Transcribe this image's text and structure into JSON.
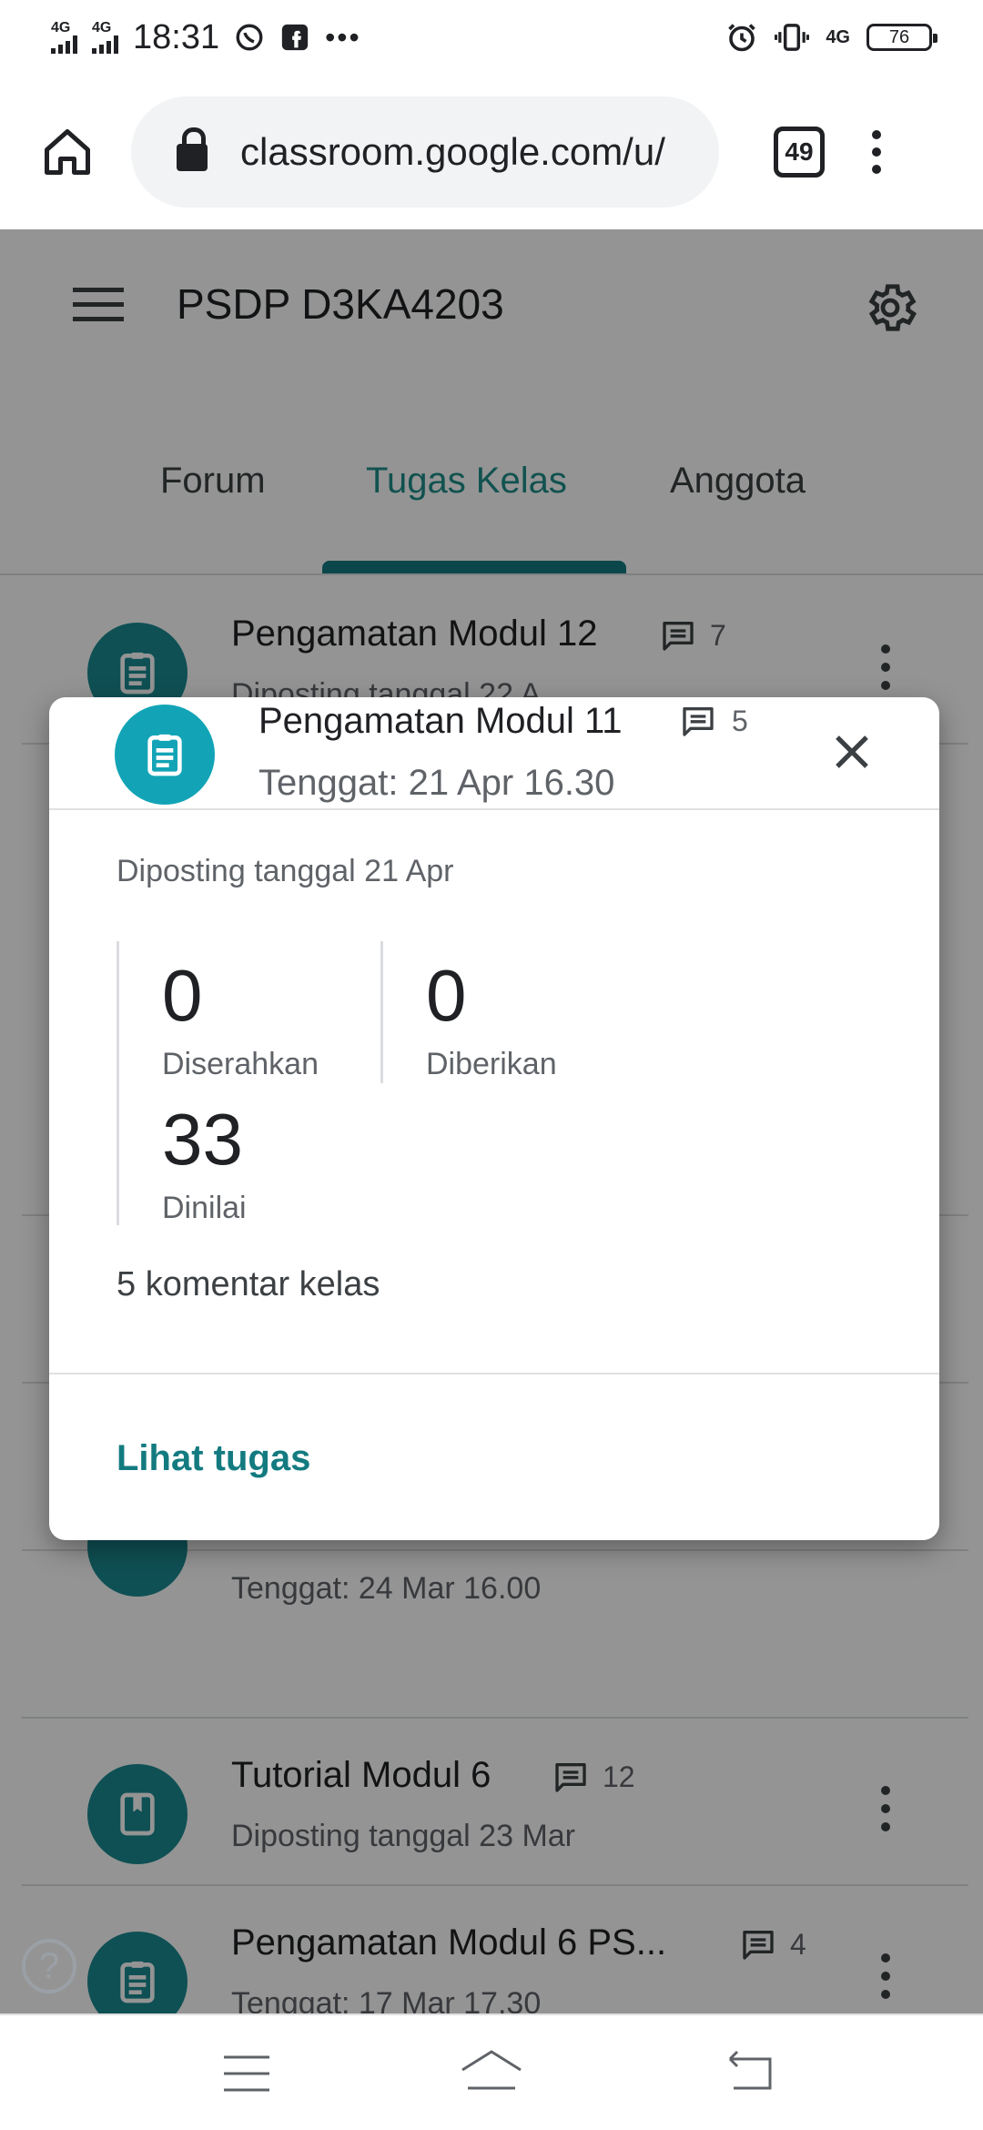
{
  "status_bar": {
    "network_1": "4G",
    "network_2": "4G",
    "time": "18:31",
    "network_3": "4G",
    "battery": "76"
  },
  "browser": {
    "url": "classroom.google.com/u/",
    "tab_count": "49"
  },
  "classroom": {
    "class_name": "PSDP D3KA4203",
    "tabs": [
      {
        "label": "Forum"
      },
      {
        "label": "Tugas Kelas"
      },
      {
        "label": "Anggota"
      }
    ],
    "active_tab": "Tugas Kelas",
    "accent_color": "#137b80",
    "items": [
      {
        "title": "Pengamatan Modul 12",
        "comments": "7",
        "subtitle": "Diposting tanggal 22 A..."
      },
      {
        "title": "",
        "comments": "",
        "subtitle": "Tenggat: 24 Mar 16.00"
      },
      {
        "title": "Tutorial Modul 6",
        "comments": "12",
        "subtitle": "Diposting tanggal 23 Mar"
      },
      {
        "title": "Pengamatan Modul 6 PS...",
        "comments": "4",
        "subtitle": "Tenggat: 17 Mar 17.30"
      }
    ],
    "help_label": "?"
  },
  "dialog": {
    "title": "Pengamatan Modul 11",
    "comment_count": "5",
    "due": "Tenggat: 21 Apr 16.30",
    "posted": "Diposting tanggal 21 Apr",
    "stats": {
      "submitted": {
        "value": "0",
        "label": "Diserahkan"
      },
      "assigned": {
        "value": "0",
        "label": "Diberikan"
      },
      "graded": {
        "value": "33",
        "label": "Dinilai"
      }
    },
    "class_comments": "5 komentar kelas",
    "view_link": "Lihat tugas",
    "icon_color": "#12a4b6"
  }
}
